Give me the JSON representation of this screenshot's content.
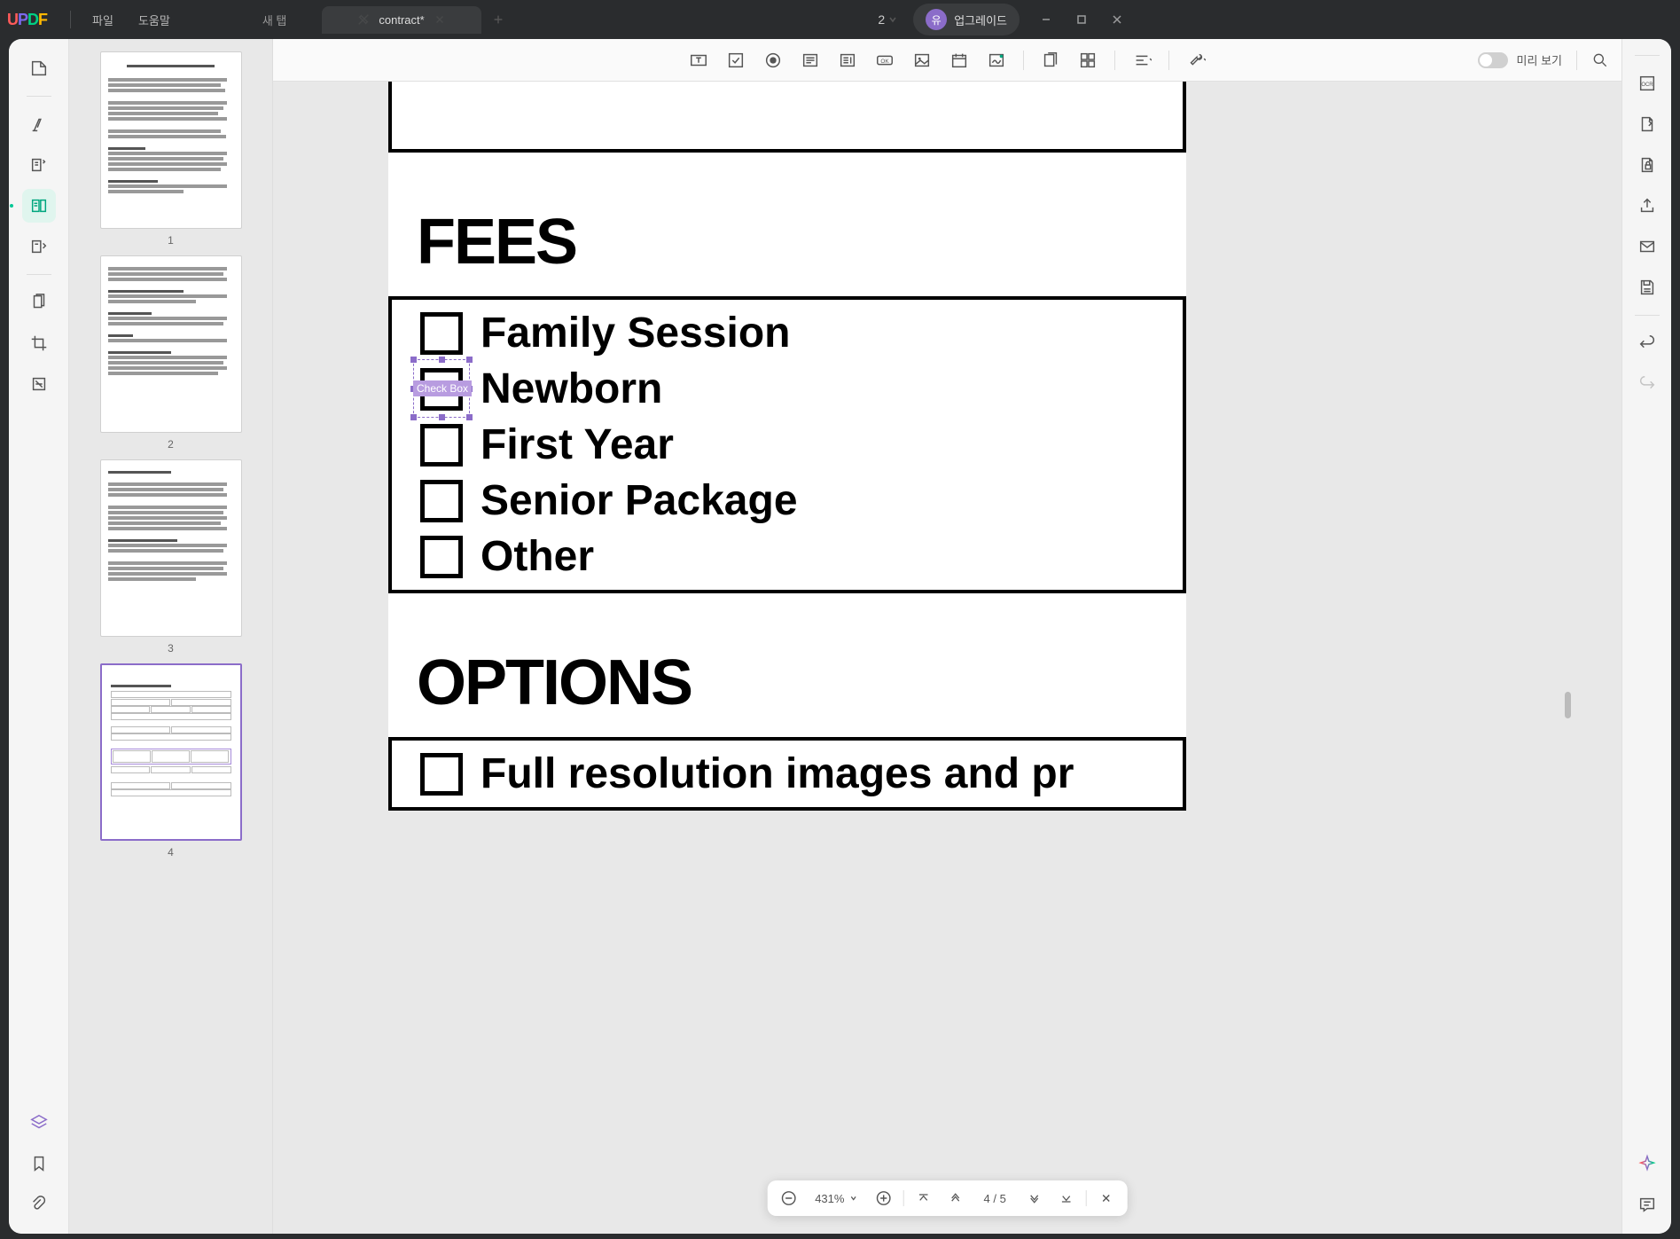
{
  "app": {
    "logo_chars": [
      "U",
      "P",
      "D",
      "F"
    ]
  },
  "menu": {
    "file": "파일",
    "help": "도움말"
  },
  "tabs": {
    "new_tab": "새 탭",
    "items": [
      {
        "title": "contract*"
      }
    ]
  },
  "titlebar": {
    "page_indicator": "2",
    "upgrade_badge": "유",
    "upgrade_label": "업그레이드"
  },
  "thumbnails": {
    "count": 4,
    "labels": [
      "1",
      "2",
      "3",
      "4"
    ]
  },
  "toolbar": {
    "preview_label": "미리 보기"
  },
  "document": {
    "sections": {
      "fees": {
        "heading": "FEES",
        "items": [
          {
            "label": "Family Session"
          },
          {
            "label": "Newborn",
            "selected_field_label": "Check Box"
          },
          {
            "label": "First Year"
          },
          {
            "label": "Senior Package"
          },
          {
            "label": "Other"
          }
        ]
      },
      "options": {
        "heading": "OPTIONS",
        "items": [
          {
            "label": "Full resolution images and pr"
          }
        ]
      }
    }
  },
  "zoom": {
    "value": "431%",
    "page_current": "4",
    "page_separator": "/",
    "page_total": "5"
  }
}
